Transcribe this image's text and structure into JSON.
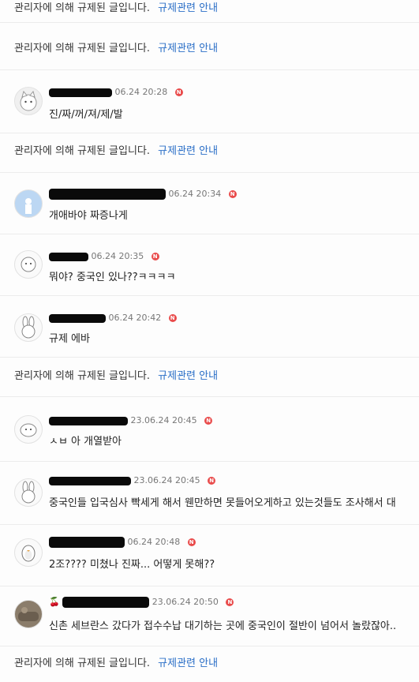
{
  "deleted_text": "관리자에 의해 규제된 글입니다.",
  "notice_link": "규제관련 안내",
  "comments": [
    {
      "date": "06.24 20:28",
      "text": "진/짜/꺼/져/제/발",
      "avatar_icon": "cat-face-icon"
    },
    {
      "date": "06.24 20:34",
      "text": "개애바야 짜증나게",
      "avatar_icon": "photo-avatar-icon"
    },
    {
      "date": "06.24 20:35",
      "text": "뭐야? 중국인 있나??ㅋㅋㅋㅋ",
      "avatar_icon": "round-face-icon"
    },
    {
      "date": "06.24 20:42",
      "text": "규제 에바",
      "avatar_icon": "bunny-icon"
    },
    {
      "date": "23.06.24 20:45",
      "text": "ㅅㅂ 아 개열받아",
      "avatar_icon": "blob-face-icon"
    },
    {
      "date": "23.06.24 20:45",
      "text": "중국인들 입국심사 빡세게 해서 웬만하면 못들어오게하고 있는것들도 조사해서 대",
      "avatar_icon": "bunny-icon"
    },
    {
      "date": "06.24 20:48",
      "text": "2조???? 미쳤나 진짜... 어떻게 못해??",
      "avatar_icon": "penguin-icon"
    },
    {
      "date": "23.06.24 20:50",
      "text": "신촌 세브란스 갔다가 접수수납 대기하는 곳에 중국인이 절반이 넘어서 놀랐잖아..",
      "avatar_icon": "photo-avatar-icon"
    }
  ],
  "colors": {
    "link": "#2b6fc7",
    "badge": "#e94b4b",
    "redaction": "#0a0a0a"
  },
  "badge_label": "N"
}
